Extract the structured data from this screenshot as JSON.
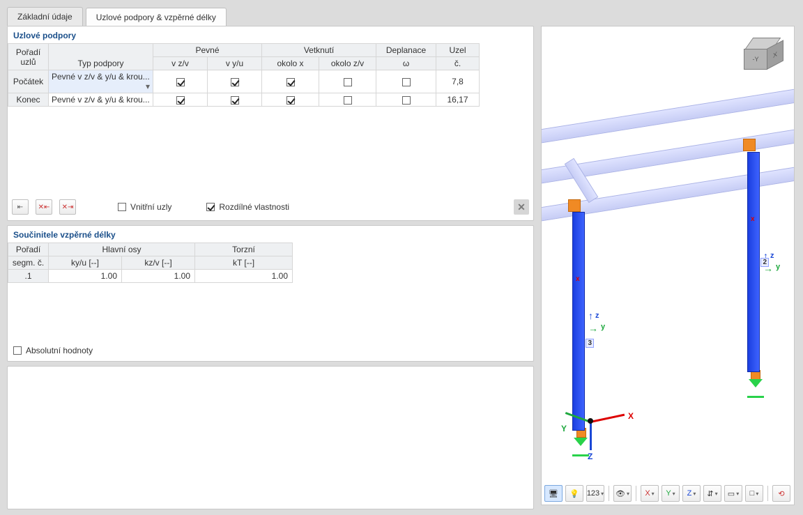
{
  "tabs": {
    "t1": "Základní údaje",
    "t2": "Uzlové podpory & vzpěrné délky"
  },
  "supports": {
    "title": "Uzlové podpory",
    "head": {
      "order": "Pořadí\nuzlů",
      "type": "Typ podpory",
      "fixed": "Pevné",
      "fixed_z": "v z/v",
      "fixed_y": "v y/u",
      "restr": "Vetknutí",
      "restr_x": "okolo x",
      "restr_z": "okolo z/v",
      "warp": "Deplanace",
      "warp_w": "ω",
      "node": "Uzel",
      "node_n": "č."
    },
    "rows": [
      {
        "order": "Počátek",
        "type": "Pevné v z/v & y/u & krou...",
        "fz": true,
        "fy": true,
        "rx": true,
        "rz": false,
        "w": false,
        "node": "7,8",
        "selected": true
      },
      {
        "order": "Konec",
        "type": "Pevné v z/v & y/u & krou...",
        "fz": true,
        "fy": true,
        "rx": true,
        "rz": false,
        "w": false,
        "node": "16,17",
        "selected": false
      }
    ],
    "footer": {
      "inner_nodes": "Vnitřní uzly",
      "diff_props": "Rozdílné vlastnosti",
      "inner_checked": false,
      "diff_checked": true
    }
  },
  "factors": {
    "title": "Součinitele vzpěrné délky",
    "head": {
      "order1": "Pořadí",
      "order2": "segm. č.",
      "main": "Hlavní osy",
      "ky": "ky/u [--]",
      "kz": "kz/v [--]",
      "tors": "Torzní",
      "kt": "kT [--]"
    },
    "rows": [
      {
        "seg": ".1",
        "ky": "1.00",
        "kz": "1.00",
        "kt": "1.00"
      }
    ],
    "footer": {
      "abs": "Absolutní hodnoty",
      "abs_checked": false
    }
  },
  "viewport": {
    "axes": {
      "x": "X",
      "y": "Y",
      "z": "Z",
      "lx": "x",
      "ly": "y",
      "lz": "z"
    },
    "members": {
      "m2": "2",
      "m3": "3"
    },
    "toolbar": {
      "b1": "🖥",
      "b2": "💡",
      "b3": "123",
      "b4": "👁",
      "b5": "X",
      "b6": "Y",
      "b7": "Z",
      "b8": "⇵",
      "b9": "▭",
      "b10": "□",
      "b11": "⟲"
    }
  }
}
